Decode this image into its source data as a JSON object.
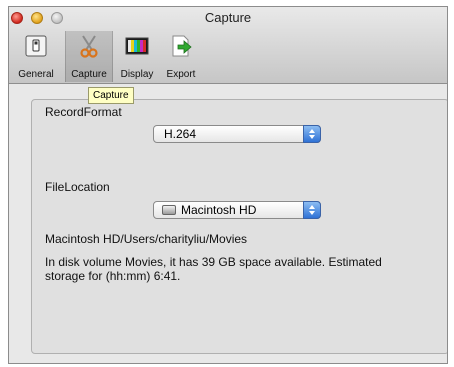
{
  "window": {
    "title": "Capture"
  },
  "toolbar": {
    "items": [
      {
        "label": "General",
        "icon": "switch-icon"
      },
      {
        "label": "Capture",
        "icon": "scissors-icon",
        "selected": true
      },
      {
        "label": "Display",
        "icon": "color-bars-icon"
      },
      {
        "label": "Export",
        "icon": "export-arrow-icon"
      }
    ]
  },
  "tooltip": {
    "text": "Capture"
  },
  "record_format": {
    "label": "RecordFormat",
    "selected": "H.264"
  },
  "file_location": {
    "label": "FileLocation",
    "selected": "Macintosh HD",
    "path": "Macintosh HD/Users/charityliu/Movies",
    "info": "In disk volume Movies, it has 39 GB space available. Estimated storage for (hh:mm) 6:41."
  },
  "colors": {
    "selection_blue": "#2f72d6",
    "tooltip_bg": "#ffffc4",
    "close_red": "#d0261c",
    "minimize_yellow": "#e1a11a"
  }
}
